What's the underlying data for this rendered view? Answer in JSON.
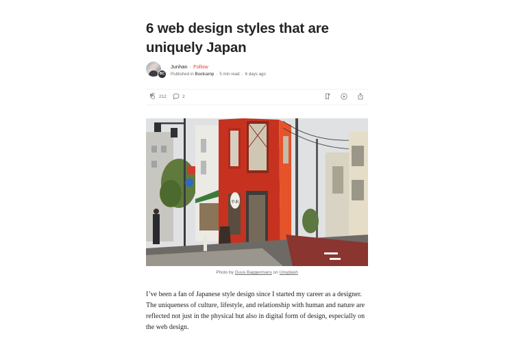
{
  "article": {
    "title": "6 web design styles that are uniquely Japan",
    "author": "Junhan",
    "follow_label": "Follow",
    "published_prefix": "Published in",
    "publication": "Bootcamp",
    "read_time": "5 min read",
    "date": "6 days ago",
    "publication_badge": "BC"
  },
  "actions": {
    "claps": "212",
    "responses": "2"
  },
  "photo": {
    "caption_prefix": "Photo by",
    "photographer": "Guus Baggermans",
    "caption_mid": "on",
    "source": "Unsplash",
    "sign_text": "やお"
  },
  "body": {
    "paragraph": "I’ve been a fan of Japanese style design since I started my career as a designer. The uniqueness of culture, lifestyle, and relationship with human and nature are reflected not just in the physical but also in digital form of design, especially on the web design."
  },
  "icons": {
    "clap": "clap-icon",
    "response": "comment-icon",
    "save": "bookmark-add-icon",
    "listen": "play-icon",
    "share": "share-icon"
  },
  "colors": {
    "follow": "#e0402e",
    "text": "#242424",
    "muted": "#6b6b6b"
  }
}
